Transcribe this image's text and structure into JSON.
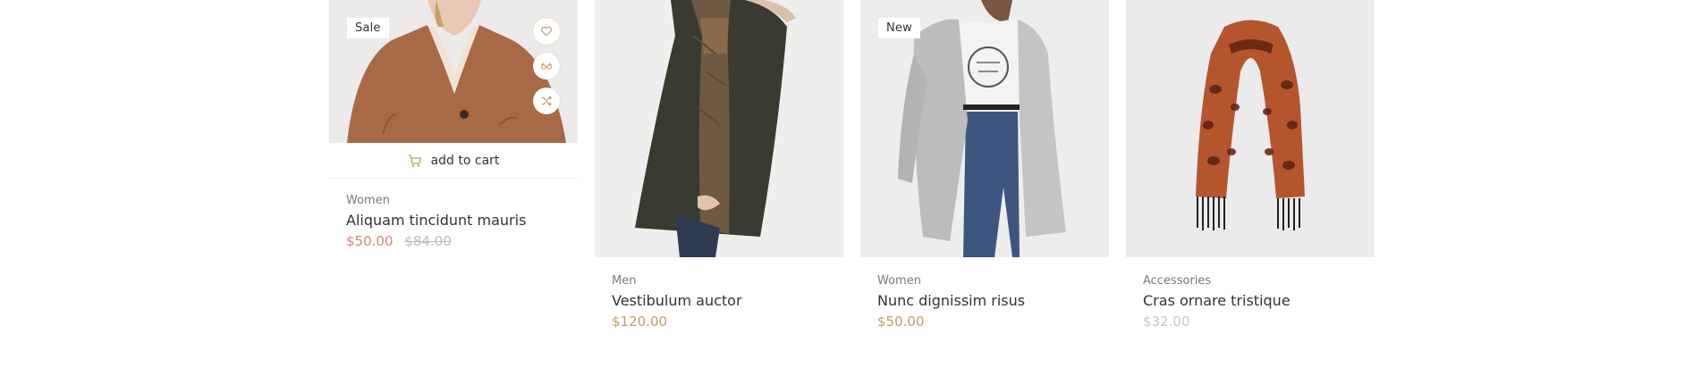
{
  "products": [
    {
      "badge": "Sale",
      "category": "Women",
      "title": "Aliquam tincidunt mauris",
      "price": "$50.00",
      "old_price": "$84.00",
      "add_to_cart": "add to cart",
      "image": "woman-brown-cardigan-photo"
    },
    {
      "category": "Men",
      "title": "Vestibulum auctor",
      "price": "$120.00",
      "image": "man-green-parka-photo"
    },
    {
      "badge": "New",
      "category": "Women",
      "title": "Nunc dignissim risus",
      "price": "$50.00",
      "image": "woman-grey-cardigan-photo"
    },
    {
      "category": "Accessories",
      "title": "Cras ornare tristique",
      "price": "$32.00",
      "image": "snake-print-scarf-photo"
    }
  ],
  "icons": {
    "wishlist": "heart-icon",
    "quickview": "glasses-icon",
    "compare": "shuffle-icon",
    "cart": "cart-icon"
  },
  "colors": {
    "sale_price": "#d08a7a",
    "regular_price": "#c49a6c",
    "old_price": "#bdbdbd",
    "muted_price": "#c8c8c8",
    "icon_accent": "#c49a6c"
  }
}
